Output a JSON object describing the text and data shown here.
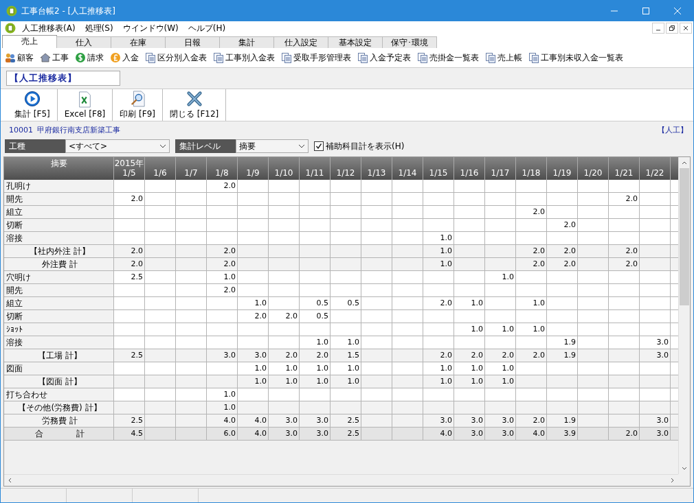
{
  "window": {
    "title": "工事台帳2 - [人工推移表]"
  },
  "menu": [
    {
      "label": "人工推移表(A)"
    },
    {
      "label": "処理(S)"
    },
    {
      "label": "ウインドウ(W)"
    },
    {
      "label": "ヘルプ(H)"
    }
  ],
  "tabs": [
    {
      "label": "売上",
      "selected": true
    },
    {
      "label": "仕入",
      "selected": false
    },
    {
      "label": "在庫",
      "selected": false
    },
    {
      "label": "日報",
      "selected": false
    },
    {
      "label": "集計",
      "selected": false
    },
    {
      "label": "仕入設定",
      "selected": false
    },
    {
      "label": "基本設定",
      "selected": false
    },
    {
      "label": "保守･環境",
      "selected": false
    }
  ],
  "quick_links": [
    {
      "label": "顧客",
      "kind": "people"
    },
    {
      "label": "工事",
      "kind": "house"
    },
    {
      "label": "請求",
      "kind": "dollar"
    },
    {
      "label": "入金",
      "kind": "pound"
    },
    {
      "label": "区分別入金表",
      "kind": "report"
    },
    {
      "label": "工事別入金表",
      "kind": "report"
    },
    {
      "label": "受取手形管理表",
      "kind": "report"
    },
    {
      "label": "入金予定表",
      "kind": "report"
    },
    {
      "label": "売掛金一覧表",
      "kind": "report"
    },
    {
      "label": "売上帳",
      "kind": "report"
    },
    {
      "label": "工事別未収入金一覧表",
      "kind": "report"
    }
  ],
  "report_title": "【人工推移表】",
  "toolbar": [
    {
      "label": "集計 [F5]",
      "kind": "run"
    },
    {
      "label": "Excel [F8]",
      "kind": "excel"
    },
    {
      "label": "印刷 [F9]",
      "kind": "print"
    },
    {
      "label": "閉じる [F12]",
      "kind": "close"
    }
  ],
  "project": {
    "code": "10001",
    "name": "甲府銀行南支店新築工事",
    "badge": "【人工】"
  },
  "filters": [
    {
      "label": "工種",
      "value": "<すべて>"
    },
    {
      "label": "集計レベル",
      "value": "摘要"
    }
  ],
  "checkbox": {
    "label": "補助科目計を表示(H)",
    "checked": true
  },
  "table": {
    "label_header": "摘要",
    "year": "2015年",
    "columns": [
      "1/5",
      "1/6",
      "1/7",
      "1/8",
      "1/9",
      "1/10",
      "1/11",
      "1/12",
      "1/13",
      "1/14",
      "1/15",
      "1/16",
      "1/17",
      "1/18",
      "1/19",
      "1/20",
      "1/21",
      "1/22"
    ],
    "rows": [
      {
        "label": "孔明け",
        "kind": "item",
        "cells": [
          null,
          null,
          null,
          "2.0",
          null,
          null,
          null,
          null,
          null,
          null,
          null,
          null,
          null,
          null,
          null,
          null,
          null,
          null
        ]
      },
      {
        "label": "開先",
        "kind": "item",
        "cells": [
          "2.0",
          null,
          null,
          null,
          null,
          null,
          null,
          null,
          null,
          null,
          null,
          null,
          null,
          null,
          null,
          null,
          "2.0",
          null
        ]
      },
      {
        "label": "組立",
        "kind": "item",
        "cells": [
          null,
          null,
          null,
          null,
          null,
          null,
          null,
          null,
          null,
          null,
          null,
          null,
          null,
          "2.0",
          null,
          null,
          null,
          null
        ]
      },
      {
        "label": "切断",
        "kind": "item",
        "cells": [
          null,
          null,
          null,
          null,
          null,
          null,
          null,
          null,
          null,
          null,
          null,
          null,
          null,
          null,
          "2.0",
          null,
          null,
          null
        ]
      },
      {
        "label": "溶接",
        "kind": "item",
        "cells": [
          null,
          null,
          null,
          null,
          null,
          null,
          null,
          null,
          null,
          null,
          "1.0",
          null,
          null,
          null,
          null,
          null,
          null,
          null
        ]
      },
      {
        "label": "【社内外注 計】",
        "kind": "subtotal",
        "cells": [
          "2.0",
          null,
          null,
          "2.0",
          null,
          null,
          null,
          null,
          null,
          null,
          "1.0",
          null,
          null,
          "2.0",
          "2.0",
          null,
          "2.0",
          null
        ]
      },
      {
        "label": "外注費 計",
        "kind": "subtotal",
        "cells": [
          "2.0",
          null,
          null,
          "2.0",
          null,
          null,
          null,
          null,
          null,
          null,
          "1.0",
          null,
          null,
          "2.0",
          "2.0",
          null,
          "2.0",
          null
        ]
      },
      {
        "label": "穴明け",
        "kind": "item",
        "cells": [
          "2.5",
          null,
          null,
          "1.0",
          null,
          null,
          null,
          null,
          null,
          null,
          null,
          null,
          "1.0",
          null,
          null,
          null,
          null,
          null
        ]
      },
      {
        "label": "開先",
        "kind": "item",
        "cells": [
          null,
          null,
          null,
          "2.0",
          null,
          null,
          null,
          null,
          null,
          null,
          null,
          null,
          null,
          null,
          null,
          null,
          null,
          null
        ]
      },
      {
        "label": "組立",
        "kind": "item",
        "cells": [
          null,
          null,
          null,
          null,
          "1.0",
          null,
          "0.5",
          "0.5",
          null,
          null,
          "2.0",
          "1.0",
          null,
          "1.0",
          null,
          null,
          null,
          null
        ]
      },
      {
        "label": "切断",
        "kind": "item",
        "cells": [
          null,
          null,
          null,
          null,
          "2.0",
          "2.0",
          "0.5",
          null,
          null,
          null,
          null,
          null,
          null,
          null,
          null,
          null,
          null,
          null
        ]
      },
      {
        "label": "ｼｮｯﾄ",
        "kind": "item",
        "cells": [
          null,
          null,
          null,
          null,
          null,
          null,
          null,
          null,
          null,
          null,
          null,
          "1.0",
          "1.0",
          "1.0",
          null,
          null,
          null,
          null
        ]
      },
      {
        "label": "溶接",
        "kind": "item",
        "cells": [
          null,
          null,
          null,
          null,
          null,
          null,
          "1.0",
          "1.0",
          null,
          null,
          null,
          null,
          null,
          null,
          "1.9",
          null,
          null,
          "3.0"
        ]
      },
      {
        "label": "【工場 計】",
        "kind": "subtotal",
        "cells": [
          "2.5",
          null,
          null,
          "3.0",
          "3.0",
          "2.0",
          "2.0",
          "1.5",
          null,
          null,
          "2.0",
          "2.0",
          "2.0",
          "2.0",
          "1.9",
          null,
          null,
          "3.0"
        ]
      },
      {
        "label": "図面",
        "kind": "item",
        "cells": [
          null,
          null,
          null,
          null,
          "1.0",
          "1.0",
          "1.0",
          "1.0",
          null,
          null,
          "1.0",
          "1.0",
          "1.0",
          null,
          null,
          null,
          null,
          null
        ]
      },
      {
        "label": "【図面 計】",
        "kind": "subtotal",
        "cells": [
          null,
          null,
          null,
          null,
          "1.0",
          "1.0",
          "1.0",
          "1.0",
          null,
          null,
          "1.0",
          "1.0",
          "1.0",
          null,
          null,
          null,
          null,
          null
        ]
      },
      {
        "label": "打ち合わせ",
        "kind": "item",
        "cells": [
          null,
          null,
          null,
          "1.0",
          null,
          null,
          null,
          null,
          null,
          null,
          null,
          null,
          null,
          null,
          null,
          null,
          null,
          null
        ]
      },
      {
        "label": "【その他(労務費) 計】",
        "kind": "subtotal",
        "cells": [
          null,
          null,
          null,
          "1.0",
          null,
          null,
          null,
          null,
          null,
          null,
          null,
          null,
          null,
          null,
          null,
          null,
          null,
          null
        ]
      },
      {
        "label": "労務費 計",
        "kind": "subtotal",
        "cells": [
          "2.5",
          null,
          null,
          "4.0",
          "4.0",
          "3.0",
          "3.0",
          "2.5",
          null,
          null,
          "3.0",
          "3.0",
          "3.0",
          "2.0",
          "1.9",
          null,
          null,
          "3.0"
        ]
      },
      {
        "label": "合　　　　計",
        "kind": "total",
        "cells": [
          "4.5",
          null,
          null,
          "6.0",
          "4.0",
          "3.0",
          "3.0",
          "2.5",
          null,
          null,
          "4.0",
          "3.0",
          "3.0",
          "4.0",
          "3.9",
          null,
          "2.0",
          "3.0"
        ]
      }
    ]
  }
}
